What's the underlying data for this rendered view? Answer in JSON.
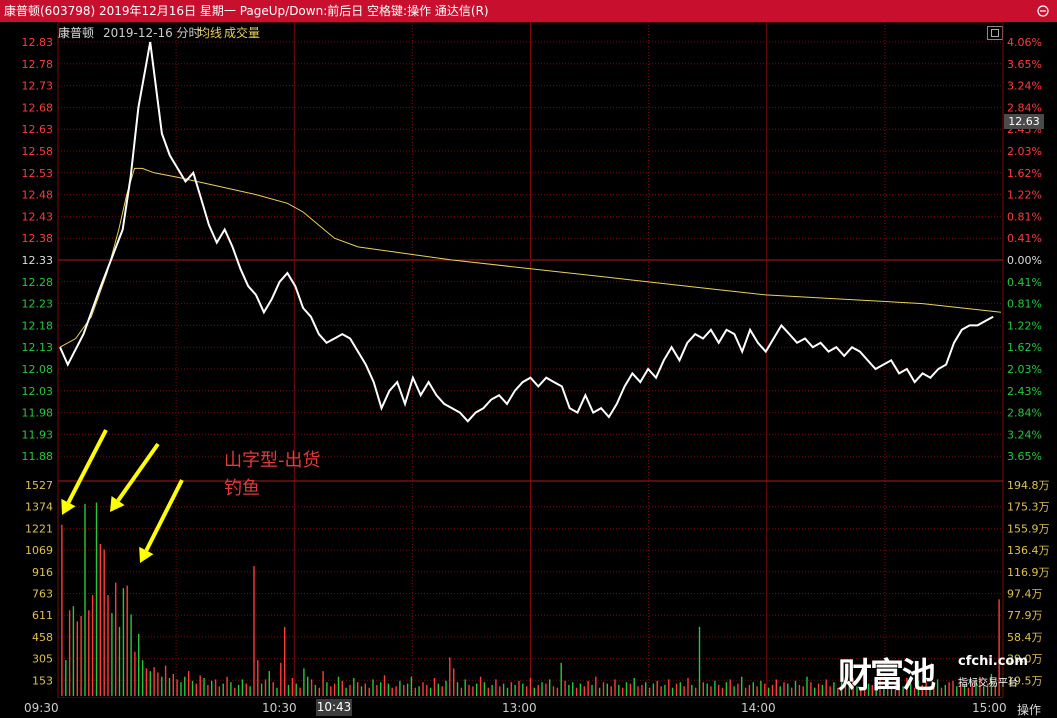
{
  "window": {
    "title": "康普顿(603798)  2019年12月16日  星期一  PageUp/Down:前后日  空格键:操作  通达信(R)"
  },
  "header": {
    "stock_name": "康普顿",
    "date_label": "2019-12-16 分时",
    "avg_label": "均线",
    "volume_label": "成交量"
  },
  "colors": {
    "title_bar": "#c8102e",
    "grid": "#7a0a0a",
    "price_line": "#ffffff",
    "avg_line": "#e8d15a",
    "up": "#ff3b3b",
    "down": "#25c83c",
    "neutral_axis": "#dddddd",
    "arrow": "#ffff00"
  },
  "current_price_tag": "12.63",
  "annotation": {
    "line1": "山字型-出货",
    "line2": "钓鱼"
  },
  "time_axis": {
    "ticks": [
      "09:30",
      "10:30",
      "13:00",
      "14:00",
      "15:00"
    ],
    "cursor": "10:43"
  },
  "op_button": "操作",
  "watermark": {
    "brand": "财富池",
    "site": "cfchi.com",
    "slogan": "指标交易平台"
  },
  "chart_data": [
    {
      "type": "line",
      "title": "",
      "price_axis": [
        "12.83",
        "12.78",
        "12.73",
        "12.68",
        "12.63",
        "12.58",
        "12.53",
        "12.48",
        "12.43",
        "12.38",
        "12.33",
        "12.28",
        "12.23",
        "12.18",
        "12.13",
        "12.08",
        "12.03",
        "11.98",
        "11.93",
        "11.88"
      ],
      "pct_axis": [
        "4.06%",
        "3.65%",
        "3.24%",
        "2.84%",
        "2.43%",
        "2.03%",
        "1.62%",
        "1.22%",
        "0.81%",
        "0.41%",
        "0.00%",
        "0.41%",
        "0.81%",
        "1.22%",
        "1.62%",
        "2.03%",
        "2.43%",
        "2.84%",
        "3.24%",
        "3.65%"
      ],
      "prev_close": 12.33,
      "ylim": [
        11.86,
        12.84
      ],
      "minutes": 240,
      "price_keypoints": [
        [
          0,
          12.13
        ],
        [
          2,
          12.09
        ],
        [
          6,
          12.16
        ],
        [
          10,
          12.26
        ],
        [
          13,
          12.33
        ],
        [
          16,
          12.4
        ],
        [
          18,
          12.52
        ],
        [
          20,
          12.68
        ],
        [
          22,
          12.78
        ],
        [
          23,
          12.83
        ],
        [
          24,
          12.76
        ],
        [
          26,
          12.62
        ],
        [
          28,
          12.57
        ],
        [
          30,
          12.54
        ],
        [
          32,
          12.51
        ],
        [
          34,
          12.53
        ],
        [
          36,
          12.47
        ],
        [
          38,
          12.41
        ],
        [
          40,
          12.37
        ],
        [
          42,
          12.4
        ],
        [
          44,
          12.36
        ],
        [
          46,
          12.31
        ],
        [
          48,
          12.27
        ],
        [
          50,
          12.25
        ],
        [
          52,
          12.21
        ],
        [
          54,
          12.24
        ],
        [
          56,
          12.28
        ],
        [
          58,
          12.3
        ],
        [
          60,
          12.27
        ],
        [
          62,
          12.22
        ],
        [
          64,
          12.2
        ],
        [
          66,
          12.16
        ],
        [
          68,
          12.14
        ],
        [
          70,
          12.15
        ],
        [
          72,
          12.16
        ],
        [
          74,
          12.15
        ],
        [
          76,
          12.12
        ],
        [
          78,
          12.09
        ],
        [
          80,
          12.05
        ],
        [
          82,
          11.99
        ],
        [
          84,
          12.03
        ],
        [
          86,
          12.05
        ],
        [
          88,
          12.0
        ],
        [
          90,
          12.06
        ],
        [
          92,
          12.02
        ],
        [
          94,
          12.05
        ],
        [
          96,
          12.02
        ],
        [
          98,
          12.0
        ],
        [
          100,
          11.99
        ],
        [
          102,
          11.98
        ],
        [
          104,
          11.96
        ],
        [
          106,
          11.98
        ],
        [
          108,
          11.99
        ],
        [
          110,
          12.01
        ],
        [
          112,
          12.02
        ],
        [
          114,
          12.0
        ],
        [
          116,
          12.03
        ],
        [
          118,
          12.05
        ],
        [
          120,
          12.06
        ],
        [
          122,
          12.04
        ],
        [
          124,
          12.06
        ],
        [
          126,
          12.05
        ],
        [
          128,
          12.04
        ],
        [
          130,
          11.99
        ],
        [
          132,
          11.98
        ],
        [
          134,
          12.02
        ],
        [
          136,
          11.98
        ],
        [
          138,
          11.99
        ],
        [
          140,
          11.97
        ],
        [
          142,
          12.0
        ],
        [
          144,
          12.04
        ],
        [
          146,
          12.07
        ],
        [
          148,
          12.05
        ],
        [
          150,
          12.08
        ],
        [
          152,
          12.06
        ],
        [
          154,
          12.1
        ],
        [
          156,
          12.13
        ],
        [
          158,
          12.1
        ],
        [
          160,
          12.14
        ],
        [
          162,
          12.16
        ],
        [
          164,
          12.15
        ],
        [
          166,
          12.17
        ],
        [
          168,
          12.14
        ],
        [
          170,
          12.17
        ],
        [
          172,
          12.16
        ],
        [
          174,
          12.12
        ],
        [
          176,
          12.17
        ],
        [
          178,
          12.14
        ],
        [
          180,
          12.12
        ],
        [
          182,
          12.15
        ],
        [
          184,
          12.18
        ],
        [
          186,
          12.16
        ],
        [
          188,
          12.14
        ],
        [
          190,
          12.15
        ],
        [
          192,
          12.13
        ],
        [
          194,
          12.14
        ],
        [
          196,
          12.12
        ],
        [
          198,
          12.13
        ],
        [
          200,
          12.11
        ],
        [
          202,
          12.13
        ],
        [
          204,
          12.12
        ],
        [
          206,
          12.1
        ],
        [
          208,
          12.08
        ],
        [
          210,
          12.09
        ],
        [
          212,
          12.1
        ],
        [
          214,
          12.07
        ],
        [
          216,
          12.08
        ],
        [
          218,
          12.05
        ],
        [
          220,
          12.07
        ],
        [
          222,
          12.06
        ],
        [
          224,
          12.08
        ],
        [
          226,
          12.09
        ],
        [
          228,
          12.14
        ],
        [
          230,
          12.17
        ],
        [
          232,
          12.18
        ],
        [
          234,
          12.18
        ],
        [
          236,
          12.19
        ],
        [
          238,
          12.2
        ]
      ],
      "avg_keypoints": [
        [
          0,
          12.13
        ],
        [
          4,
          12.15
        ],
        [
          8,
          12.2
        ],
        [
          12,
          12.3
        ],
        [
          15,
          12.4
        ],
        [
          17,
          12.48
        ],
        [
          19,
          12.54
        ],
        [
          21,
          12.54
        ],
        [
          24,
          12.53
        ],
        [
          30,
          12.52
        ],
        [
          40,
          12.5
        ],
        [
          50,
          12.48
        ],
        [
          58,
          12.46
        ],
        [
          62,
          12.44
        ],
        [
          66,
          12.41
        ],
        [
          70,
          12.38
        ],
        [
          76,
          12.36
        ],
        [
          84,
          12.35
        ],
        [
          100,
          12.33
        ],
        [
          120,
          12.31
        ],
        [
          140,
          12.29
        ],
        [
          160,
          12.27
        ],
        [
          180,
          12.25
        ],
        [
          200,
          12.24
        ],
        [
          220,
          12.23
        ],
        [
          240,
          12.21
        ]
      ]
    },
    {
      "type": "bar",
      "title": "",
      "volume_axis": [
        "1527",
        "1374",
        "1221",
        "1069",
        "916",
        "763",
        "611",
        "458",
        "305",
        "153"
      ],
      "volume_axis_right": [
        "194.8万",
        "175.3万",
        "155.9万",
        "136.4万",
        "116.9万",
        "97.4万",
        "77.9万",
        "58.4万",
        "39.0万",
        "19.5万"
      ],
      "ylim": [
        0,
        1527
      ],
      "volumes": [
        1240,
        260,
        620,
        650,
        540,
        580,
        1390,
        620,
        730,
        1400,
        1100,
        1060,
        730,
        600,
        820,
        500,
        780,
        800,
        590,
        320,
        450,
        260,
        200,
        180,
        210,
        170,
        140,
        220,
        130,
        160,
        120,
        100,
        140,
        180,
        110,
        90,
        150,
        130,
        80,
        110,
        120,
        70,
        90,
        140,
        100,
        60,
        80,
        120,
        90,
        70,
        940,
        260,
        90,
        120,
        180,
        100,
        60,
        240,
        500,
        80,
        130,
        90,
        60,
        200,
        140,
        120,
        80,
        60,
        180,
        100,
        70,
        90,
        140,
        110,
        60,
        80,
        130,
        100,
        70,
        90,
        60,
        120,
        80,
        100,
        150,
        90,
        60,
        70,
        110,
        80,
        90,
        140,
        60,
        70,
        100,
        80,
        60,
        130,
        90,
        70,
        110,
        280,
        200,
        100,
        60,
        120,
        80,
        70,
        90,
        140,
        100,
        60,
        80,
        120,
        70,
        90,
        60,
        100,
        80,
        110,
        90,
        70,
        130,
        60,
        80,
        100,
        90,
        120,
        70,
        60,
        240,
        110,
        80,
        100,
        60,
        90,
        70,
        110,
        80,
        140,
        60,
        100,
        90,
        70,
        120,
        80,
        60,
        100,
        90,
        130,
        70,
        80,
        100,
        60,
        90,
        110,
        70,
        80,
        120,
        60,
        90,
        100,
        70,
        130,
        80,
        60,
        500,
        100,
        90,
        70,
        110,
        80,
        60,
        100,
        120,
        70,
        90,
        140,
        60,
        80,
        100,
        70,
        110,
        90,
        60,
        80,
        120,
        70,
        100,
        90,
        60,
        110,
        80,
        70,
        140,
        100,
        60,
        90,
        80,
        120,
        70,
        100,
        60,
        110,
        90,
        80,
        130,
        70,
        60,
        100,
        90,
        80,
        110,
        120,
        70,
        90,
        60,
        100,
        80,
        70,
        130,
        90,
        60,
        110,
        80,
        100,
        70,
        90,
        120,
        60,
        80,
        100,
        110,
        70,
        90,
        80,
        60,
        100,
        120,
        140,
        70,
        90,
        160,
        80,
        700
      ],
      "colors_seq": "rgrgrrgrrgrrrgrggrgrggrgrrgrgrrggrgrrgrgrrgrgrggrgrrgrgrgrrgrgrggrgrrgrrgrgrgrgrrgrgrgrrgrggrgrrgrgrgrrgrgrrgrgrgrrggrgrgrrgrgrgrrgrggrgrrgrgrgrrgrgrgrrgrgrrgrgrgrrgrgrgrgrrgrgrgrrgrgrgrrgrgrgrrgrgrgrrgrgrgrgrrgrgrgrgrrgrgrgrrgrgrgrrgrgrrgrgrgrrgrgrgrg"
    }
  ]
}
